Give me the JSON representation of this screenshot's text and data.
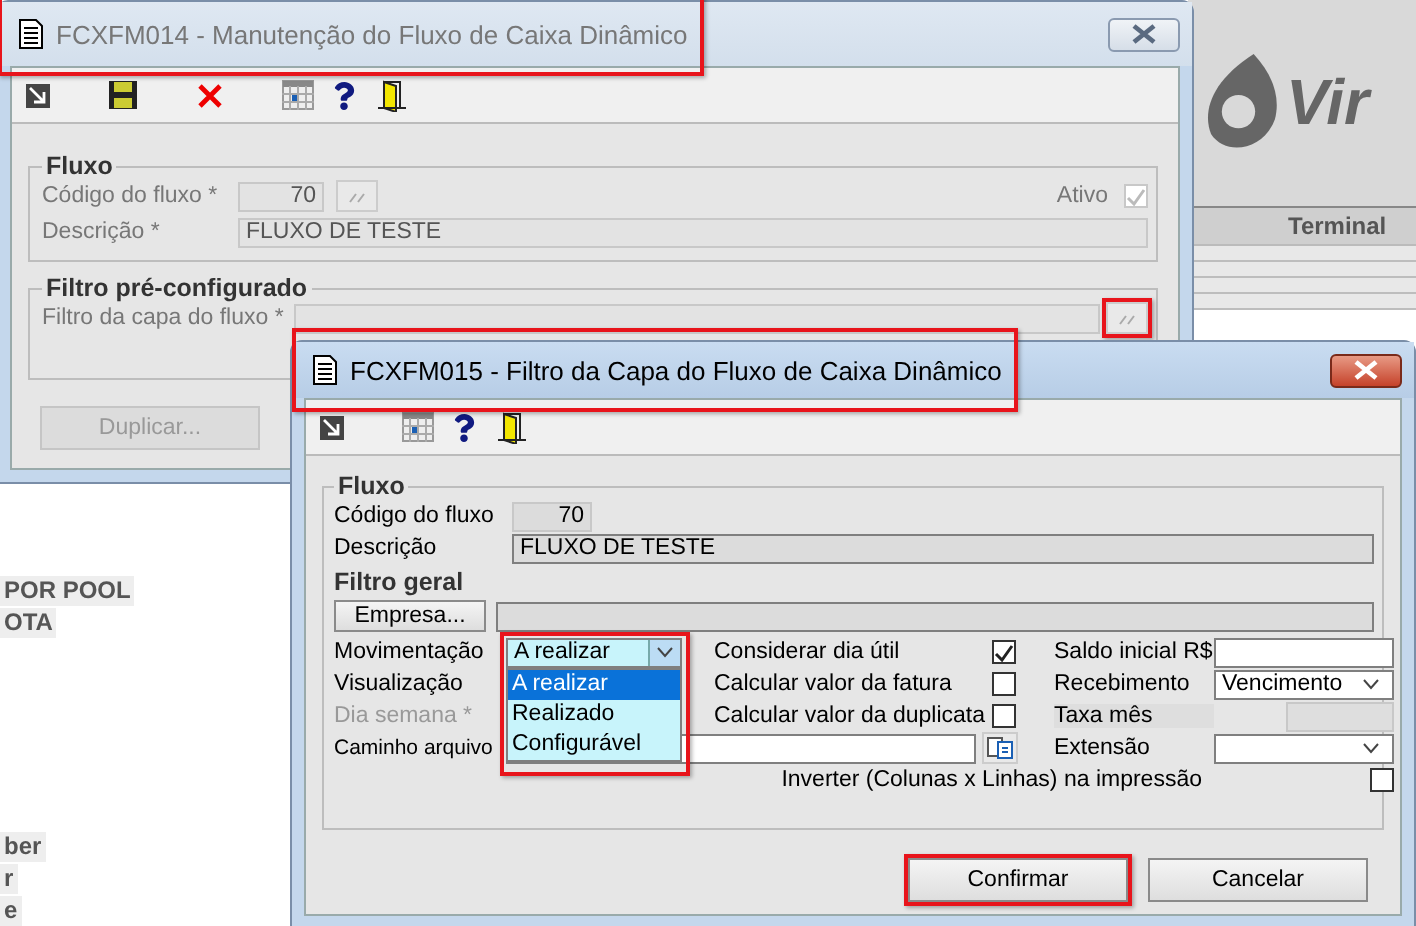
{
  "background_app": {
    "logo_text": "Vir",
    "table_header": "Terminal",
    "side_labels": [
      "POR POOL",
      "OTA",
      "ber",
      "r",
      "e"
    ]
  },
  "main_window": {
    "title": "FCXFM014 - Manutenção do Fluxo de Caixa Dinâmico",
    "active": false,
    "highlighted": true,
    "flow_group": {
      "legend": "Fluxo",
      "code_label": "Código do fluxo *",
      "code_value": "70",
      "active_label": "Ativo",
      "active_checked": true,
      "description_label": "Descrição *",
      "description_value": "FLUXO DE TESTE"
    },
    "preset_group": {
      "legend": "Filtro pré-configurado",
      "filter_label": "Filtro da capa do fluxo *",
      "lookup_highlighted": true
    },
    "duplicate_button": {
      "label": "Duplicar...",
      "disabled": true
    }
  },
  "filter_window": {
    "title": "FCXFM015 - Filtro da Capa do Fluxo de Caixa Dinâmico",
    "active": true,
    "highlighted": true,
    "flow_group": {
      "legend": "Fluxo",
      "code_label": "Código do fluxo",
      "code_value": "70",
      "description_label": "Descrição",
      "description_value": "FLUXO DE TESTE"
    },
    "general_group": {
      "legend": "Filtro geral",
      "company_button": "Empresa...",
      "movement": {
        "label": "Movimentação",
        "value": "A realizar",
        "expanded": true,
        "highlighted": true,
        "options": [
          {
            "label": "A realizar",
            "selected": true
          },
          {
            "label": "Realizado",
            "selected": false
          },
          {
            "label": "Configurável",
            "selected": false
          }
        ]
      },
      "view_label": "Visualização",
      "weekday": {
        "label": "Dia semana *",
        "disabled": true
      },
      "path_label": "Caminho arquivo",
      "options": [
        {
          "label": "Considerar dia útil",
          "checked": true
        },
        {
          "label": "Calcular valor da fatura",
          "checked": false
        },
        {
          "label": "Calcular valor da duplicata",
          "checked": false
        }
      ],
      "initial_balance_label": "Saldo inicial R$",
      "receipt": {
        "label": "Recebimento",
        "value": "Vencimento"
      },
      "monthly_rate": {
        "label": "Taxa mês",
        "disabled": true
      },
      "extension_label": "Extensão",
      "invert": {
        "label": "Inverter (Colunas x Linhas) na impressão",
        "checked": false
      }
    },
    "buttons": [
      {
        "label": "Confirmar",
        "highlighted": true
      },
      {
        "label": "Cancelar",
        "highlighted": false
      }
    ]
  }
}
